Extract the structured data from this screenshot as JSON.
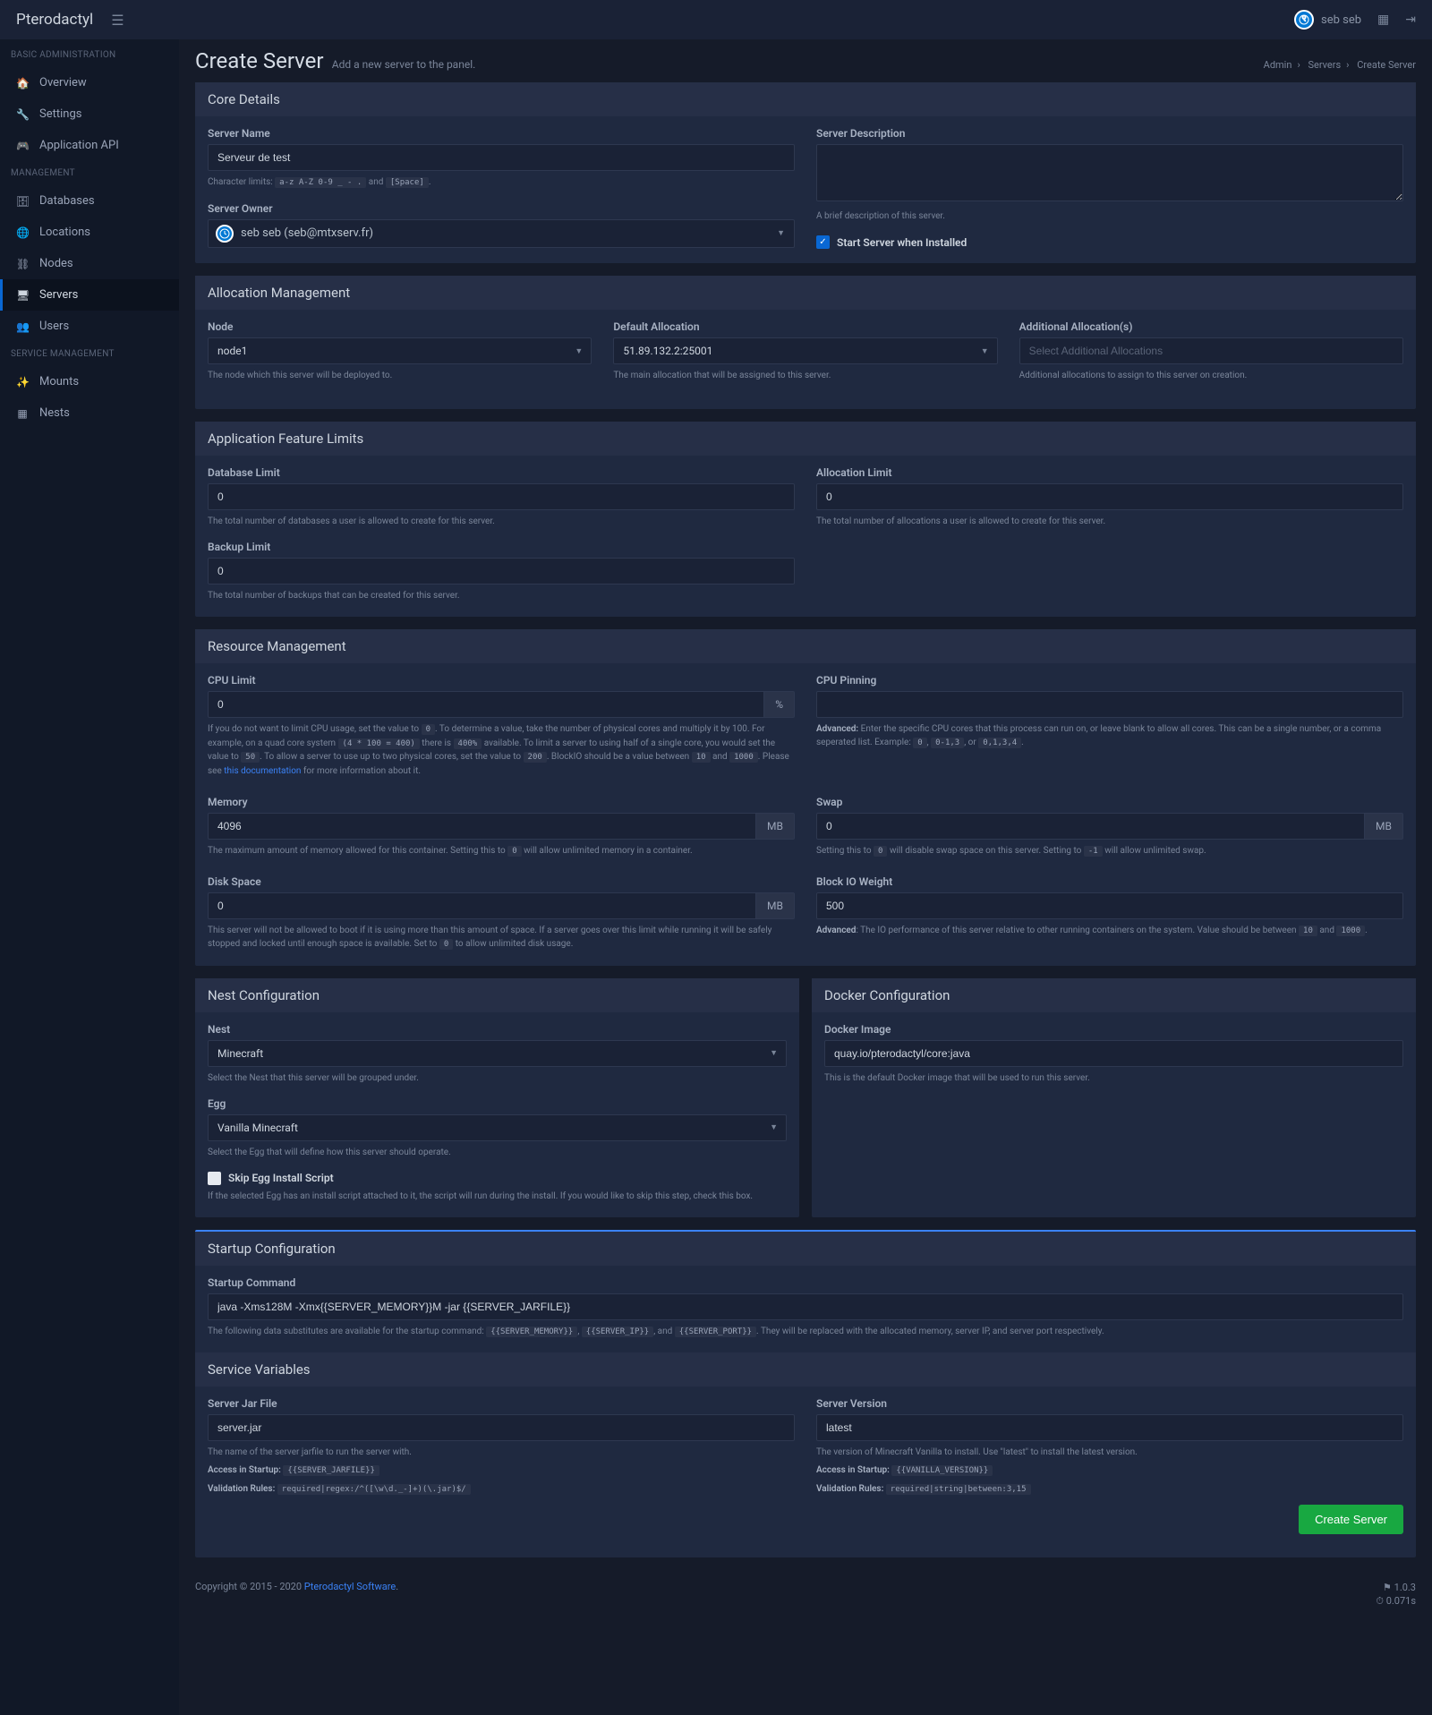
{
  "brand": "Pterodactyl",
  "user": {
    "name": "seb seb"
  },
  "breadcrumb": {
    "admin": "Admin",
    "servers": "Servers",
    "current": "Create Server"
  },
  "page": {
    "title": "Create Server",
    "subtitle": "Add a new server to the panel."
  },
  "sidebar": {
    "headers": {
      "basic": "BASIC ADMINISTRATION",
      "mgmt": "MANAGEMENT",
      "svc": "SERVICE MANAGEMENT"
    },
    "items": {
      "overview": "Overview",
      "settings": "Settings",
      "api": "Application API",
      "databases": "Databases",
      "locations": "Locations",
      "nodes": "Nodes",
      "servers": "Servers",
      "users": "Users",
      "mounts": "Mounts",
      "nests": "Nests"
    }
  },
  "core": {
    "header": "Core Details",
    "name_label": "Server Name",
    "name_value": "Serveur de test",
    "name_help_pre": "Character limits:",
    "name_chip1": "a-z A-Z 0-9 _ - .",
    "name_help_mid": "and",
    "name_chip2": "[Space]",
    "owner_label": "Server Owner",
    "owner_display": "seb seb (seb@mtxserv.fr)",
    "desc_label": "Server Description",
    "desc_help": "A brief description of this server.",
    "start_label": "Start Server when Installed"
  },
  "alloc": {
    "header": "Allocation Management",
    "node_label": "Node",
    "node_value": "node1",
    "node_help": "The node which this server will be deployed to.",
    "default_label": "Default Allocation",
    "default_value": "51.89.132.2:25001",
    "default_help": "The main allocation that will be assigned to this server.",
    "addl_label": "Additional Allocation(s)",
    "addl_placeholder": "Select Additional Allocations",
    "addl_help": "Additional allocations to assign to this server on creation."
  },
  "limits": {
    "header": "Application Feature Limits",
    "db_label": "Database Limit",
    "db_value": "0",
    "db_help": "The total number of databases a user is allowed to create for this server.",
    "alloc_label": "Allocation Limit",
    "alloc_value": "0",
    "alloc_help": "The total number of allocations a user is allowed to create for this server.",
    "backup_label": "Backup Limit",
    "backup_value": "0",
    "backup_help": "The total number of backups that can be created for this server."
  },
  "resource": {
    "header": "Resource Management",
    "cpu_label": "CPU Limit",
    "cpu_value": "0",
    "cpu_unit": "%",
    "cpu_help_1": "If you do not want to limit CPU usage, set the value to ",
    "cpu_chip1": "0",
    "cpu_help_2": ". To determine a value, take the number of physical cores and multiply it by 100. For example, on a quad core system ",
    "cpu_chip2": "(4 * 100 = 400)",
    "cpu_help_3": " there is ",
    "cpu_chip3": "400%",
    "cpu_help_4": " available. To limit a server to using half of a single core, you would set the value to ",
    "cpu_chip4": "50",
    "cpu_help_5": ". To allow a server to use up to two physical cores, set the value to ",
    "cpu_chip5": "200",
    "cpu_help_6": ". BlockIO should be a value between ",
    "cpu_chip6": "10",
    "cpu_help_7": " and ",
    "cpu_chip7": "1000",
    "cpu_help_8": ". Please see ",
    "cpu_link": "this documentation",
    "cpu_help_9": " for more information about it.",
    "pin_label": "CPU Pinning",
    "pin_bold": "Advanced:",
    "pin_help_1": " Enter the specific CPU cores that this process can run on, or leave blank to allow all cores. This can be a single number, or a comma seperated list. Example: ",
    "pin_chip1": "0",
    "pin_help_2": ", ",
    "pin_chip2": "0-1,3",
    "pin_help_3": ", or ",
    "pin_chip3": "0,1,3,4",
    "mem_label": "Memory",
    "mem_value": "4096",
    "mem_unit": "MB",
    "mem_help_1": "The maximum amount of memory allowed for this container. Setting this to ",
    "mem_chip1": "0",
    "mem_help_2": " will allow unlimited memory in a container.",
    "swap_label": "Swap",
    "swap_value": "0",
    "swap_unit": "MB",
    "swap_help_1": "Setting this to ",
    "swap_chip1": "0",
    "swap_help_2": " will disable swap space on this server. Setting to ",
    "swap_chip2": "-1",
    "swap_help_3": " will allow unlimited swap.",
    "disk_label": "Disk Space",
    "disk_value": "0",
    "disk_unit": "MB",
    "disk_help_1": "This server will not be allowed to boot if it is using more than this amount of space. If a server goes over this limit while running it will be safely stopped and locked until enough space is available. Set to ",
    "disk_chip1": "0",
    "disk_help_2": " to allow unlimited disk usage.",
    "io_label": "Block IO Weight",
    "io_value": "500",
    "io_bold": "Advanced",
    "io_help_1": ": The IO performance of this server relative to other running containers on the system. Value should be between ",
    "io_chip1": "10",
    "io_help_2": " and ",
    "io_chip2": "1000",
    "io_help_3": "."
  },
  "nest": {
    "header": "Nest Configuration",
    "nest_label": "Nest",
    "nest_value": "Minecraft",
    "nest_help": "Select the Nest that this server will be grouped under.",
    "egg_label": "Egg",
    "egg_value": "Vanilla Minecraft",
    "egg_help": "Select the Egg that will define how this server should operate.",
    "skip_label": "Skip Egg Install Script",
    "skip_help": "If the selected Egg has an install script attached to it, the script will run during the install. If you would like to skip this step, check this box."
  },
  "docker": {
    "header": "Docker Configuration",
    "img_label": "Docker Image",
    "img_value": "quay.io/pterodactyl/core:java",
    "img_help": "This is the default Docker image that will be used to run this server."
  },
  "startup": {
    "header": "Startup Configuration",
    "cmd_label": "Startup Command",
    "cmd_value": "java -Xms128M -Xmx{{SERVER_MEMORY}}M -jar {{SERVER_JARFILE}}",
    "cmd_help_1": "The following data substitutes are available for the startup command: ",
    "cmd_chip1": "{{SERVER_MEMORY}}",
    "cmd_help_2": ", ",
    "cmd_chip2": "{{SERVER_IP}}",
    "cmd_help_3": ", and ",
    "cmd_chip3": "{{SERVER_PORT}}",
    "cmd_help_4": ". They will be replaced with the allocated memory, server IP, and server port respectively."
  },
  "svcvars": {
    "header": "Service Variables",
    "jar_label": "Server Jar File",
    "jar_value": "server.jar",
    "jar_help": "The name of the server jarfile to run the server with.",
    "jar_access_label": "Access in Startup:",
    "jar_access_chip": "{{SERVER_JARFILE}}",
    "jar_rules_label": "Validation Rules:",
    "jar_rules_chip": "required|regex:/^([\\w\\d._-]+)(\\.jar)$/",
    "ver_label": "Server Version",
    "ver_value": "latest",
    "ver_help": "The version of Minecraft Vanilla to install. Use \"latest\" to install the latest version.",
    "ver_access_label": "Access in Startup:",
    "ver_access_chip": "{{VANILLA_VERSION}}",
    "ver_rules_label": "Validation Rules:",
    "ver_rules_chip": "required|string|between:3,15"
  },
  "create_btn": "Create Server",
  "footer": {
    "copy": "Copyright © 2015 - 2020 ",
    "link": "Pterodactyl Software",
    "version": "1.0.3",
    "time": "0.071s"
  }
}
